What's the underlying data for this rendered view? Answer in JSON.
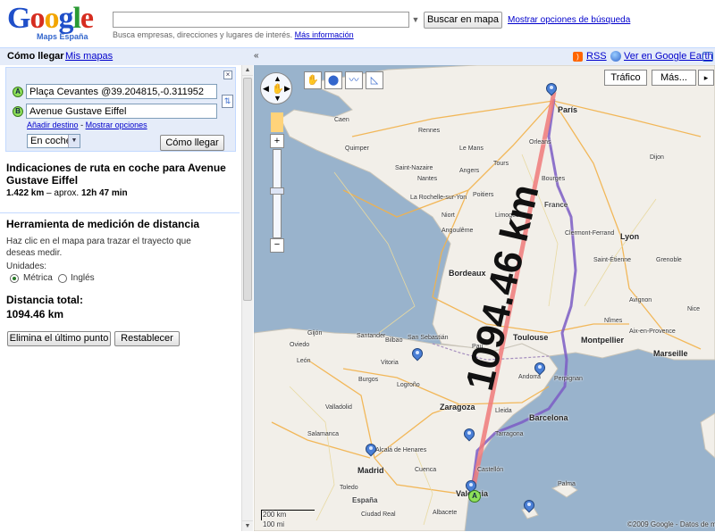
{
  "header": {
    "logo_text": "Google",
    "logo_sub": "Maps España",
    "search_value": "",
    "search_button": "Buscar en mapa",
    "search_options": "Mostrar opciones de búsqueda",
    "search_hint": "Busca empresas, direcciones y lugares de interés.",
    "more_info": "Más información"
  },
  "topbar": {
    "tab_directions": "Cómo llegar",
    "tab_my_maps": "Mis mapas",
    "collapse": "«",
    "rss": "RSS",
    "earth": "Ver en Google Earth"
  },
  "directions": {
    "from_marker": "A",
    "to_marker": "B",
    "from": "Plaça Cevantes @39.204815,-0.311952",
    "to": "Avenue Gustave Eiffel",
    "add_destination": "Añadir destino",
    "separator": "-",
    "show_options": "Mostrar opciones",
    "mode": "En coche",
    "submit": "Cómo llegar"
  },
  "route": {
    "title": "Indicaciones de ruta en coche para Avenue Gustave Eiffel",
    "distance": "1.422 km",
    "approx": "– aprox.",
    "time": "12h 47 min"
  },
  "tool": {
    "title": "Herramienta de medición de distancia",
    "hint": "Haz clic en el mapa para trazar el trayecto que deseas medir.",
    "units_label": "Unidades:",
    "unit_metric": "Métrica",
    "unit_imperial": "Inglés",
    "selected_unit": "metric",
    "total_label": "Distancia total:",
    "total_value": "1094.46 km",
    "undo_button": "Elimina el último punto",
    "reset_button": "Restablecer"
  },
  "map": {
    "traffic_button": "Tráfico",
    "more_button": "Más...",
    "distance_overlay": "1094.46 km",
    "copyright": "©2009 Google - Datos de ma",
    "scale_km": "200 km",
    "scale_mi": "100 mi",
    "colors": {
      "sea": "#99b3cc",
      "land": "#f2efe9",
      "measure_line": "#f07b7b",
      "route": "#7b5cc4",
      "pin": "#4a7fd6"
    },
    "labels": {
      "paris": "París",
      "rennes": "Rennes",
      "nantes": "Nantes",
      "bordeaux": "Bordeaux",
      "france": "France",
      "lyon": "Lyon",
      "montpellier": "Montpellier",
      "marseille": "Marseille",
      "toulouse": "Toulouse",
      "andorra": "Andorra",
      "perpignan": "Perpignan",
      "barcelona": "Barcelona",
      "zaragoza": "Zaragoza",
      "madrid": "Madrid",
      "espana": "España",
      "valencia": "Valencia",
      "bilbao": "Bilbao",
      "san_sebastian": "San Sebastián",
      "leon": "León",
      "burgos": "Burgos",
      "valladolid": "Valladolid",
      "salamanca": "Salamanca",
      "gijon": "Gijón",
      "santander": "Santander",
      "lleida": "Lleida",
      "nimes": "Nîmes",
      "limoges": "Limoges",
      "poitiers": "Poitiers",
      "tours": "Tours",
      "orleans": "Orleans",
      "bourges": "Bourges",
      "clermont": "Clermont-Ferrand",
      "saint_etienne": "Saint-Étienne",
      "grenoble": "Grenoble",
      "dijon": "Dijon",
      "caen": "Caen",
      "le_mans": "Le Mans",
      "angers": "Angers",
      "quimper": "Quimper",
      "saint_nazaire": "Saint-Nazaire",
      "la_rochelle": "La Rochelle-sur-Yon",
      "niort": "Niort",
      "angouleme": "Angoulême",
      "aix": "Aix-en-Provence",
      "avignon": "Avignon",
      "nice": "Nice",
      "palma": "Palma",
      "pau": "Pau",
      "logrono": "Logroño",
      "vitoria": "Vitoria",
      "oviedo": "Oviedo",
      "alcala": "Alcalá de Henares",
      "tarragona": "Tarragona",
      "castellon": "Castellón",
      "albacete": "Albacete",
      "cuenca": "Cuenca",
      "toledo": "Toledo",
      "ciudad_real": "Ciudad Real"
    }
  }
}
